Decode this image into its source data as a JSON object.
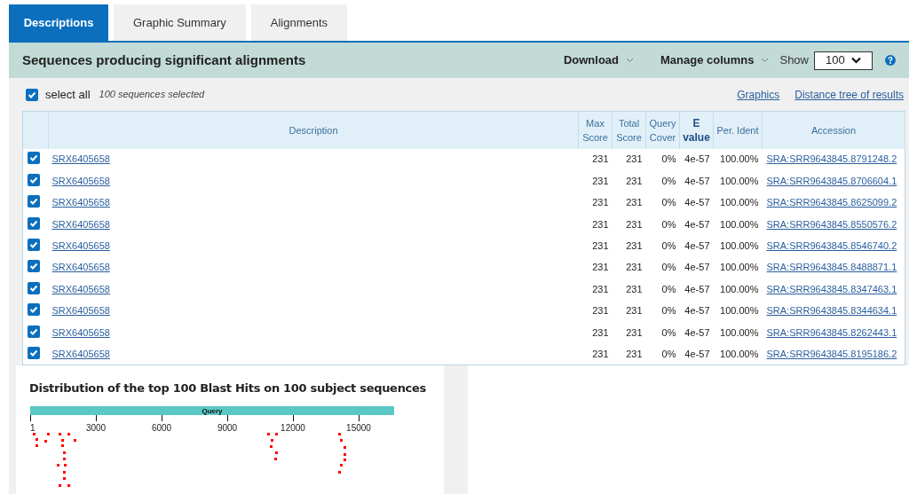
{
  "tabs": [
    {
      "label": "Descriptions",
      "selected": true
    },
    {
      "label": "Graphic Summary",
      "selected": false
    },
    {
      "label": "Alignments",
      "selected": false
    }
  ],
  "header": {
    "title": "Sequences producing significant alignments",
    "download": "Download",
    "manage_columns": "Manage columns",
    "show_label": "Show",
    "show_value": "100"
  },
  "selection": {
    "label": "select all",
    "checked": true,
    "count": "100 sequences selected"
  },
  "links": [
    "Graphics",
    "Distance tree of results"
  ],
  "table": {
    "columns": [
      {
        "label": "Description",
        "bold": false
      },
      {
        "label": "Max Score",
        "bold": false
      },
      {
        "label": "Total Score",
        "bold": false
      },
      {
        "label": "Query Cover",
        "bold": false
      },
      {
        "label": "E value",
        "bold": true
      },
      {
        "label": "Per. Ident",
        "bold": false
      },
      {
        "label": "Accession",
        "bold": false
      }
    ],
    "rows": [
      {
        "checked": true,
        "description": "SRX6405658",
        "max_score": "231",
        "total_score": "231",
        "query_cover": "0%",
        "e_value": "4e-57",
        "per_ident": "100.00%",
        "accession": "SRA:SRR9643845.8791248.2"
      },
      {
        "checked": true,
        "description": "SRX6405658",
        "max_score": "231",
        "total_score": "231",
        "query_cover": "0%",
        "e_value": "4e-57",
        "per_ident": "100.00%",
        "accession": "SRA:SRR9643845.8706604.1"
      },
      {
        "checked": true,
        "description": "SRX6405658",
        "max_score": "231",
        "total_score": "231",
        "query_cover": "0%",
        "e_value": "4e-57",
        "per_ident": "100.00%",
        "accession": "SRA:SRR9643845.8625099.2"
      },
      {
        "checked": true,
        "description": "SRX6405658",
        "max_score": "231",
        "total_score": "231",
        "query_cover": "0%",
        "e_value": "4e-57",
        "per_ident": "100.00%",
        "accession": "SRA:SRR9643845.8550576.2"
      },
      {
        "checked": true,
        "description": "SRX6405658",
        "max_score": "231",
        "total_score": "231",
        "query_cover": "0%",
        "e_value": "4e-57",
        "per_ident": "100.00%",
        "accession": "SRA:SRR9643845.8546740.2"
      },
      {
        "checked": true,
        "description": "SRX6405658",
        "max_score": "231",
        "total_score": "231",
        "query_cover": "0%",
        "e_value": "4e-57",
        "per_ident": "100.00%",
        "accession": "SRA:SRR9643845.8488871.1"
      },
      {
        "checked": true,
        "description": "SRX6405658",
        "max_score": "231",
        "total_score": "231",
        "query_cover": "0%",
        "e_value": "4e-57",
        "per_ident": "100.00%",
        "accession": "SRA:SRR9643845.8347463.1"
      },
      {
        "checked": true,
        "description": "SRX6405658",
        "max_score": "231",
        "total_score": "231",
        "query_cover": "0%",
        "e_value": "4e-57",
        "per_ident": "100.00%",
        "accession": "SRA:SRR9643845.8344634.1"
      },
      {
        "checked": true,
        "description": "SRX6405658",
        "max_score": "231",
        "total_score": "231",
        "query_cover": "0%",
        "e_value": "4e-57",
        "per_ident": "100.00%",
        "accession": "SRA:SRR9643845.8262443.1"
      },
      {
        "checked": true,
        "description": "SRX6405658",
        "max_score": "231",
        "total_score": "231",
        "query_cover": "0%",
        "e_value": "4e-57",
        "per_ident": "100.00%",
        "accession": "SRA:SRR9643845.8195186.2"
      }
    ]
  },
  "distribution": {
    "title": "Distribution of the top 100 Blast Hits on 100 subject sequences",
    "query_label": "Query",
    "ticks": [
      "1",
      "3000",
      "6000",
      "9000",
      "12000",
      "15000"
    ]
  }
}
